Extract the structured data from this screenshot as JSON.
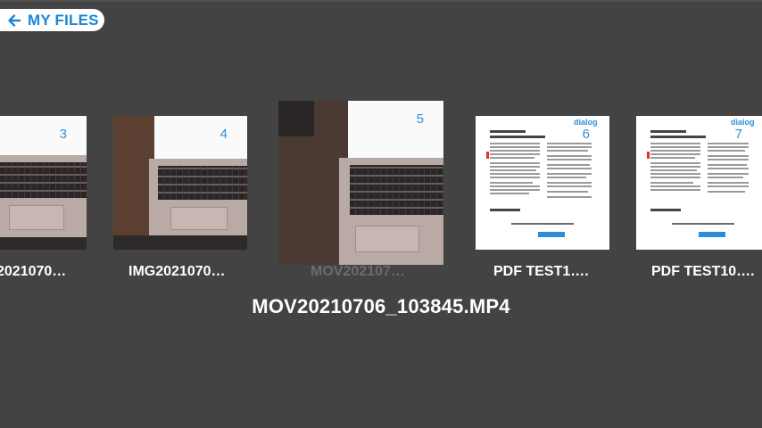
{
  "header": {
    "back_label": "MY FILES",
    "accent_color": "#1a86d6"
  },
  "files": [
    {
      "index": "3",
      "caption": "2021070…",
      "kind": "photo"
    },
    {
      "index": "4",
      "caption": "IMG2021070…",
      "kind": "photo"
    },
    {
      "index": "5",
      "caption": "MOV202107…",
      "kind": "video",
      "selected": true
    },
    {
      "index": "6",
      "caption": "PDF TEST1….",
      "kind": "pdf",
      "logo": "dialog"
    },
    {
      "index": "7",
      "caption": "PDF TEST10….",
      "kind": "pdf",
      "logo": "dialog"
    }
  ],
  "selected_title": "MOV20210706_103845.MP4"
}
